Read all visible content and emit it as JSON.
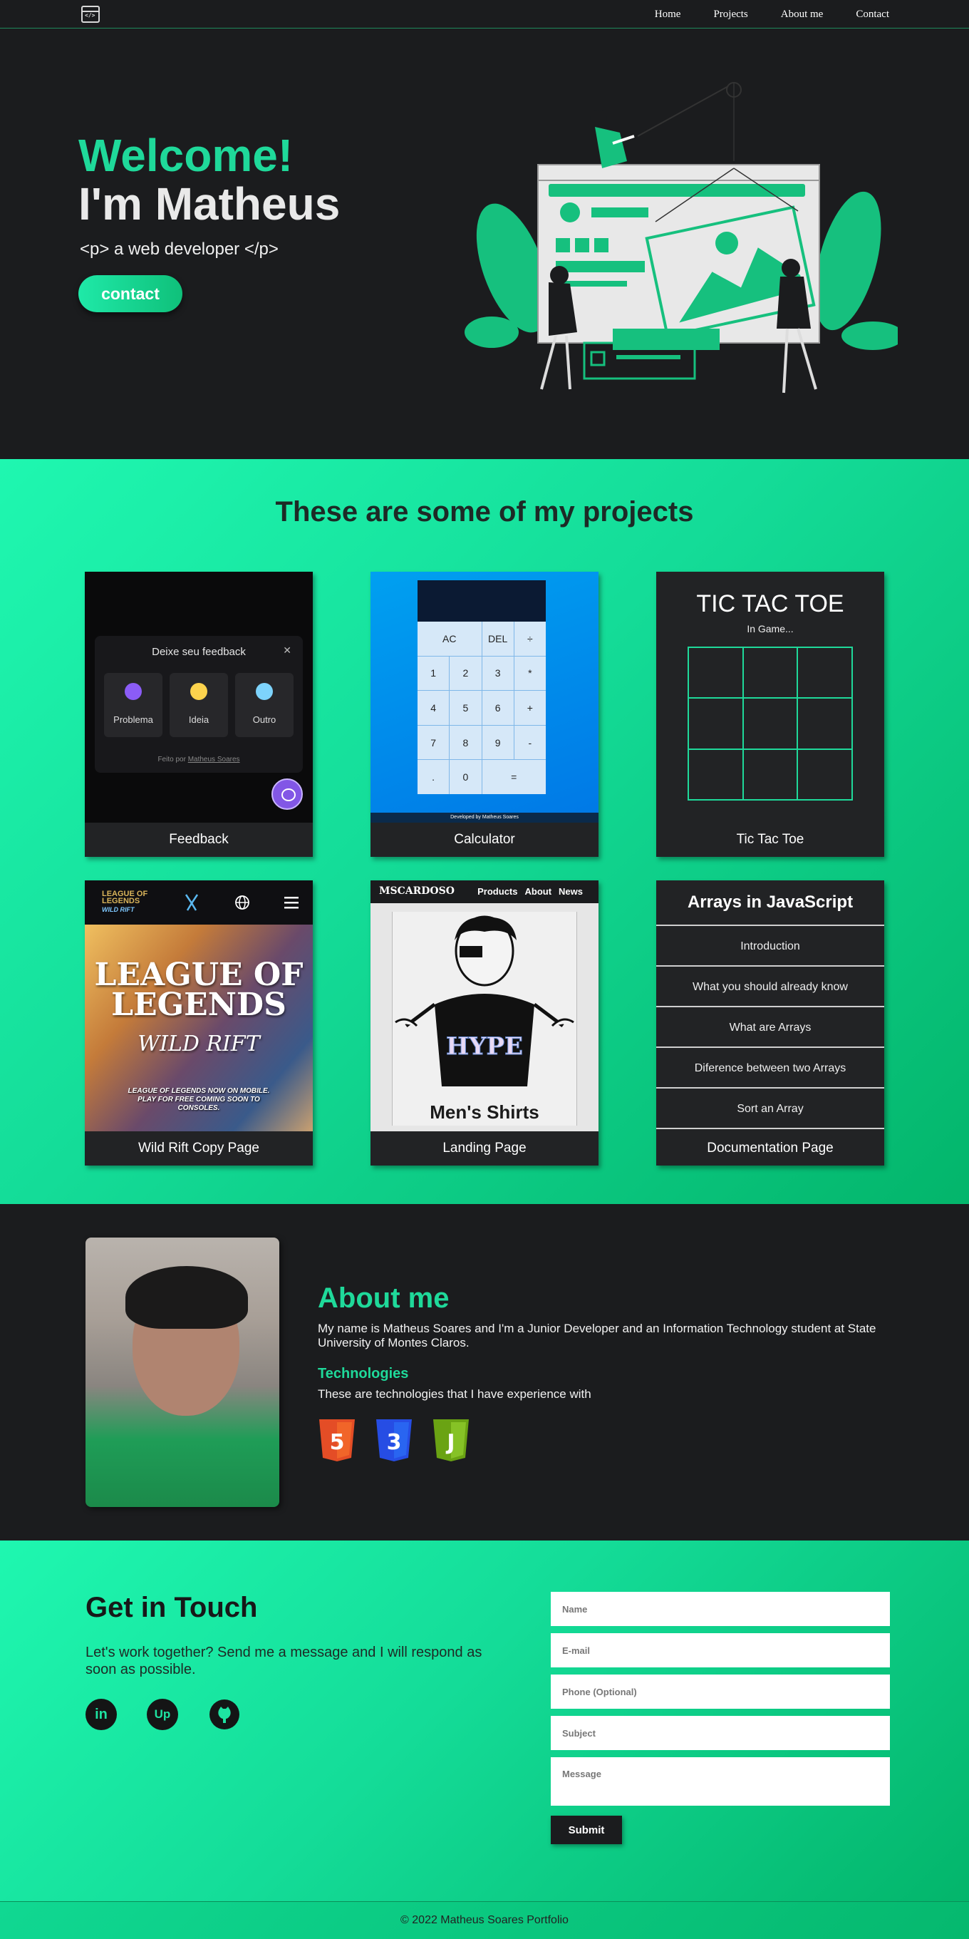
{
  "nav": {
    "logo_icon": "code-window-icon",
    "logo_glyph": "</>",
    "links": [
      "Home",
      "Projects",
      "About me",
      "Contact"
    ]
  },
  "hero": {
    "welcome": "Welcome!",
    "name": "I'm Matheus",
    "role": "<p> a web developer </p>",
    "contact_button": "contact"
  },
  "projects": {
    "title": "These are some of my projects",
    "cards": [
      {
        "label": "Feedback"
      },
      {
        "label": "Calculator"
      },
      {
        "label": "Tic Tac Toe"
      },
      {
        "label": "Wild Rift Copy Page"
      },
      {
        "label": "Landing Page"
      },
      {
        "label": "Documentation Page"
      }
    ],
    "feedback_preview": {
      "heading": "Deixe seu feedback",
      "options": [
        "Problema",
        "Ideia",
        "Outro"
      ],
      "footer_prefix": "Feito por",
      "footer_name": "Matheus Soares"
    },
    "calculator_preview": {
      "keys": [
        "AC",
        "DEL",
        "÷",
        "1",
        "2",
        "3",
        "*",
        "4",
        "5",
        "6",
        "+",
        "7",
        "8",
        "9",
        "-",
        ".",
        "0",
        "="
      ],
      "footer": "Developed by Matheus Soares"
    },
    "tictactoe_preview": {
      "title": "TIC TAC TOE",
      "status": "In Game..."
    },
    "wildrift_preview": {
      "logo_top": "LEAGUE OF LEGENDS",
      "logo_sub": "WILD RIFT",
      "headline": "LEAGUE OF LEGENDS",
      "subline": "WILD RIFT",
      "tagline": "LEAGUE OF LEGENDS NOW ON MOBILE. PLAY FOR FREE COMING SOON TO CONSOLES."
    },
    "landing_preview": {
      "brand": "MSCARDOSO",
      "nav": [
        "Products",
        "About",
        "News"
      ],
      "shirt_text": "HYPE",
      "caption": "Men's Shirts"
    },
    "docs_preview": {
      "title": "Arrays in JavaScript",
      "items": [
        "Introduction",
        "What you should already know",
        "What are Arrays",
        "Diference between two Arrays",
        "Sort an Array"
      ]
    }
  },
  "about": {
    "title": "About me",
    "text": "My name is Matheus Soares and I'm a Junior Developer and an Information Technology student at State University of Montes Claros.",
    "tech_title": "Technologies",
    "tech_text": "These are technologies that I have experience with",
    "tech_icons": [
      "html5-icon",
      "css3-icon",
      "javascript-icon"
    ],
    "badge_glyphs": [
      "5",
      "3",
      "J"
    ],
    "colors": {
      "html": "#e44d26",
      "css": "#264de4",
      "js": "#7cb518"
    }
  },
  "contact": {
    "title": "Get in Touch",
    "text": "Let's work together? Send me a message and I will respond as soon as possible.",
    "social_icons": [
      "linkedin-icon",
      "upwork-icon",
      "github-icon"
    ],
    "social_glyphs": [
      "in",
      "Up",
      "gh"
    ],
    "placeholders": {
      "name": "Name",
      "email": "E-mail",
      "phone": "Phone (Optional)",
      "subject": "Subject",
      "message": "Message"
    },
    "submit": "Submit"
  },
  "footer": {
    "copyright": "© 2022 Matheus Soares Portfolio"
  },
  "colors": {
    "accent": "#1fd99a",
    "dark": "#1b1c1e",
    "gradient_start": "#1ff7b0",
    "gradient_end": "#03b56b"
  }
}
